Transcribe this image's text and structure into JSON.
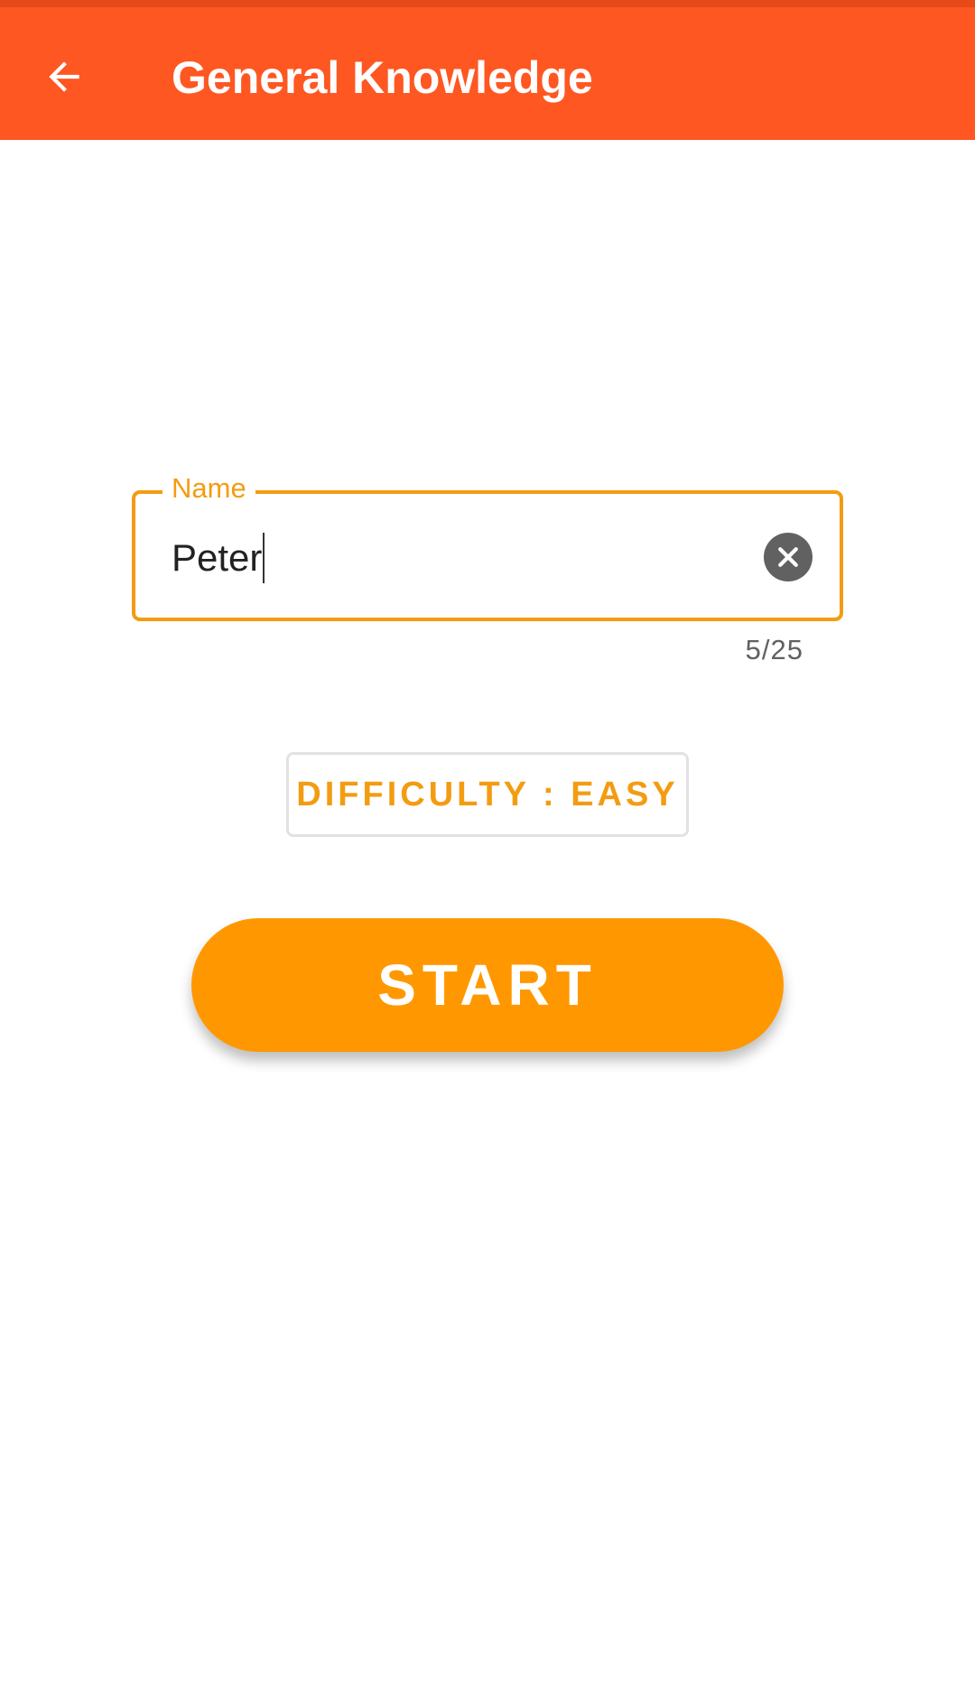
{
  "app_bar": {
    "title": "General Knowledge",
    "back_icon": "arrow-back-icon",
    "background_color": "#FF5722",
    "status_color": "#E64A19"
  },
  "name_field": {
    "label": "Name",
    "value": "Peter",
    "clear_icon": "close-circle-icon",
    "counter": "5/25",
    "accent_color": "#F39C12"
  },
  "difficulty_button": {
    "label": "DIFFICULTY : EASY"
  },
  "start_button": {
    "label": "START",
    "color": "#FF9800"
  }
}
